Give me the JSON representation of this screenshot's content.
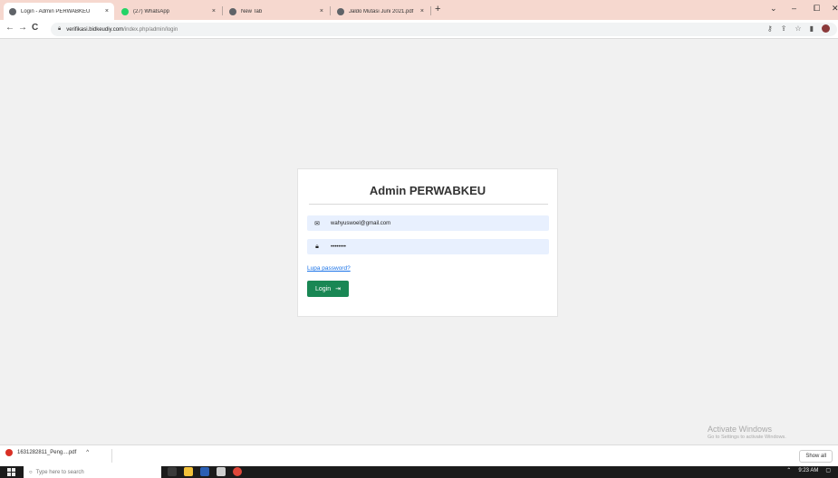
{
  "browser": {
    "tabs": [
      {
        "label": "Login - Admin PERWABKEU",
        "favicon_color": "#5f6368",
        "active": true
      },
      {
        "label": "(27) WhatsApp",
        "favicon_color": "#25d366",
        "active": false
      },
      {
        "label": "New Tab",
        "favicon_color": "#5f6368",
        "active": false
      },
      {
        "label": "Jaldo Mutasi Juni 2021.pdf",
        "favicon_color": "#5f6368",
        "active": false
      }
    ],
    "close_glyph": "×",
    "new_tab_glyph": "+",
    "window_controls": [
      "⌄",
      "–",
      "⧠",
      "✕"
    ],
    "url_host": "verifikasi.bidkeudiy.com",
    "url_path": "/index.php/admin/login",
    "nav": [
      "←",
      "→",
      "C"
    ]
  },
  "login": {
    "title": "Admin PERWABKEU",
    "email_value": "wahyuswoel@gmail.com",
    "password_value": "••••••••",
    "forgot_label": "Lupa password?",
    "login_label": "Login",
    "accent_color": "#198754"
  },
  "watermark": {
    "line1": "Activate Windows",
    "line2": "Go to Settings to activate Windows."
  },
  "downloads": {
    "item_label": "1631282811_Peng....pdf",
    "chevron": "^",
    "show_all_label": "Show all"
  },
  "taskbar": {
    "search_placeholder": "Type here to search",
    "time": "9:23 AM"
  }
}
